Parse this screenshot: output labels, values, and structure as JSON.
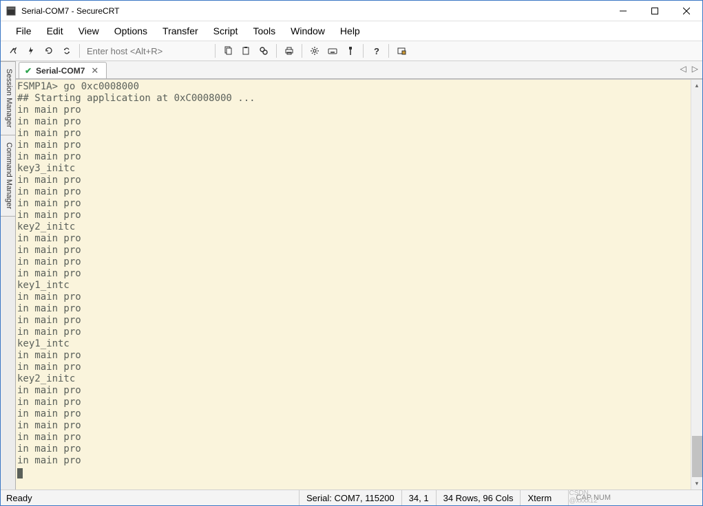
{
  "titlebar": {
    "title": "Serial-COM7 - SecureCRT"
  },
  "menubar": {
    "items": [
      "File",
      "Edit",
      "View",
      "Options",
      "Transfer",
      "Script",
      "Tools",
      "Window",
      "Help"
    ]
  },
  "toolbar": {
    "host_placeholder": "Enter host <Alt+R>"
  },
  "side_panels": {
    "session_manager": "Session Manager",
    "command_manager": "Command Manager"
  },
  "tab": {
    "label": "Serial-COM7",
    "close": "✕",
    "check": "✔"
  },
  "terminal_lines": [
    "FSMP1A> go 0xc0008000",
    "## Starting application at 0xC0008000 ...",
    "in main pro",
    "in main pro",
    "in main pro",
    "in main pro",
    "in main pro",
    "key3_initc",
    "in main pro",
    "in main pro",
    "in main pro",
    "in main pro",
    "key2_initc",
    "in main pro",
    "in main pro",
    "in main pro",
    "in main pro",
    "key1_intc",
    "in main pro",
    "in main pro",
    "in main pro",
    "in main pro",
    "key1_intc",
    "in main pro",
    "in main pro",
    "key2_initc",
    "in main pro",
    "in main pro",
    "in main pro",
    "in main pro",
    "in main pro",
    "in main pro",
    "in main pro"
  ],
  "status": {
    "ready": "Ready",
    "serial": "Serial: COM7, 115200",
    "cursor": "34,  1",
    "rowscols": "34 Rows, 96 Cols",
    "term": "Xterm",
    "indicators": "CAP NUM"
  },
  "watermark": "CSDN @xxxx12"
}
